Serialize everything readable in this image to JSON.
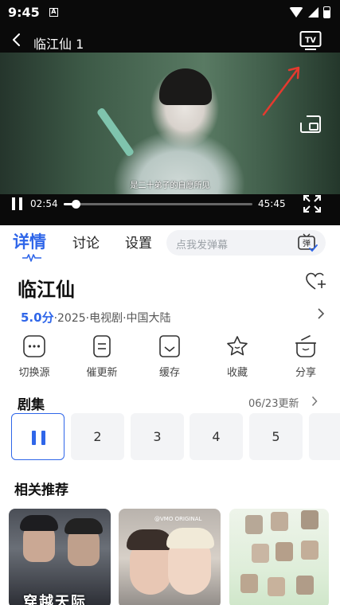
{
  "status_bar": {
    "time": "9:45",
    "a_badge": "A"
  },
  "player": {
    "episode_title": "临江仙 1",
    "subtitle": "是二十弟子的自愿所见",
    "current_time": "02:54",
    "total_time": "45:45",
    "progress": 0.0634
  },
  "tabs": [
    {
      "label": "详情"
    },
    {
      "label": "讨论"
    },
    {
      "label": "设置"
    }
  ],
  "danmaku": {
    "placeholder": "点我发弹幕",
    "icon_char": "弹"
  },
  "show": {
    "title": "临江仙",
    "score": "5.0分",
    "meta": "·2025·电视剧·中国大陆"
  },
  "actions": [
    {
      "label": "切换源",
      "icon": "switch-source-icon"
    },
    {
      "label": "催更新",
      "icon": "update-request-icon"
    },
    {
      "label": "缓存",
      "icon": "download-cache-icon"
    },
    {
      "label": "收藏",
      "icon": "star-favorite-icon"
    },
    {
      "label": "分享",
      "icon": "share-icon"
    }
  ],
  "episodes": {
    "heading": "剧集",
    "update": "06/23更新",
    "items": [
      "2",
      "3",
      "4",
      "5"
    ]
  },
  "recommend": {
    "heading": "相关推荐",
    "posters": [
      {
        "text": "穿越天际"
      },
      {
        "tag": "@VMO ORIGINAL"
      },
      {}
    ]
  },
  "colors": {
    "accent": "#2f66e9",
    "annotation_arrow": "#e53a2f"
  }
}
